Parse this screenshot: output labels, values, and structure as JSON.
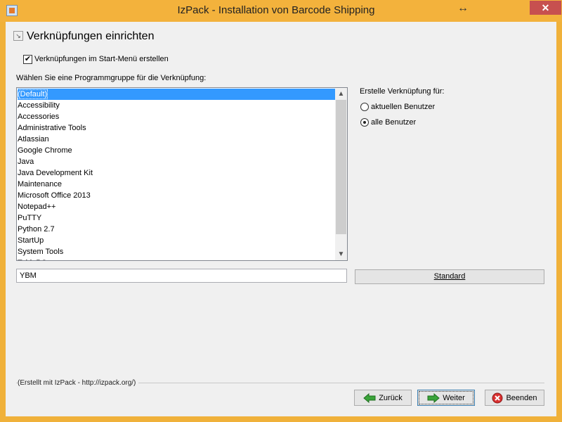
{
  "window": {
    "title": "IzPack - Installation von  Barcode Shipping",
    "close_glyph": "✕",
    "resize_glyph": "↔"
  },
  "panel": {
    "title": "Verknüpfungen einrichten",
    "create_start_menu_label": "Verknüpfungen im Start-Menü erstellen",
    "create_start_menu_checked": true,
    "program_group_label": "Wählen Sie eine Programmgruppe für die Verknüpfung:",
    "program_groups": [
      "(Default)",
      "Accessibility",
      "Accessories",
      "Administrative Tools",
      "Atlassian",
      "Google Chrome",
      "Java",
      "Java Development Kit",
      "Maintenance",
      "Microsoft Office 2013",
      "Notepad++",
      "PuTTY",
      "Python 2.7",
      "StartUp",
      "System Tools",
      "TablePC"
    ],
    "selected_group": "(Default)",
    "create_for_label": "Erstelle Verknüpfung für:",
    "radio_current_user": "aktuellen Benutzer",
    "radio_all_users": "alle Benutzer",
    "selected_user_option": "alle Benutzer",
    "group_name_value": "YBM",
    "standard_button": "Standard"
  },
  "footer": {
    "made_with": "(Erstellt mit IzPack - http://izpack.org/)",
    "back_button": "Zurück",
    "next_button": "Weiter",
    "quit_button": "Beenden"
  },
  "colors": {
    "titlebar": "#f3b23c",
    "selection": "#3399ff",
    "close": "#c7504f",
    "arrow_green": "#3aa43a",
    "quit_red": "#d93030"
  }
}
